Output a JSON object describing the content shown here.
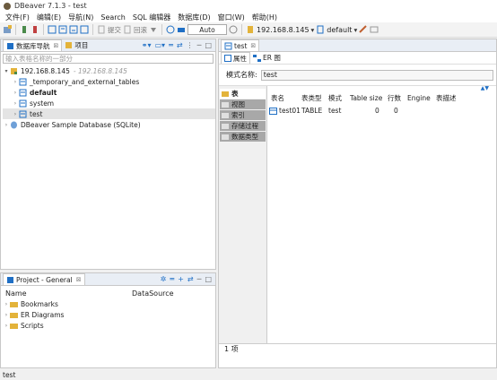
{
  "window": {
    "title": "DBeaver 7.1.3 - test"
  },
  "menu": [
    "文件(F)",
    "编辑(E)",
    "导航(N)",
    "Search",
    "SQL 编辑器",
    "数据库(D)",
    "窗口(W)",
    "帮助(H)"
  ],
  "toolbar": {
    "commit_label": "提交",
    "rollback_label": "回滚",
    "transaction_mode": "Auto",
    "connection": "192.168.8.145",
    "schema": "default"
  },
  "navigator": {
    "tab_db": "数据库导航",
    "tab_project": "项目",
    "filter_placeholder": "输入表格名称的一部分",
    "tree": {
      "connection": "192.168.8.145",
      "connection_host": "- 192.168.8.145",
      "schemas": [
        "_temporary_and_external_tables",
        "default",
        "system",
        "test"
      ],
      "sample_db": "DBeaver Sample Database (SQLite)"
    }
  },
  "project_panel": {
    "title": "Project - General",
    "col_name": "Name",
    "col_datasource": "DataSource",
    "items": [
      "Bookmarks",
      "ER Diagrams",
      "Scripts"
    ]
  },
  "editor": {
    "tab_title": "test",
    "subtab_props": "属性",
    "subtab_er": "ER 图",
    "schema_label": "模式名称:",
    "schema_value": "test",
    "side_tabs": [
      "表",
      "视图",
      "索引",
      "存储过程",
      "数据类型"
    ],
    "columns": [
      "表名",
      "表类型",
      "模式",
      "Table size",
      "行数",
      "Engine",
      "表描述"
    ],
    "rows": [
      {
        "name": "test01",
        "type": "TABLE",
        "schema": "test",
        "size": "0",
        "rows": "0",
        "engine": "",
        "desc": ""
      }
    ],
    "footer": "1 项"
  },
  "status": {
    "text": "test"
  },
  "colors": {
    "accent": "#1f6fc5",
    "folder": "#e3b33a",
    "selection": "#cde3f7"
  }
}
